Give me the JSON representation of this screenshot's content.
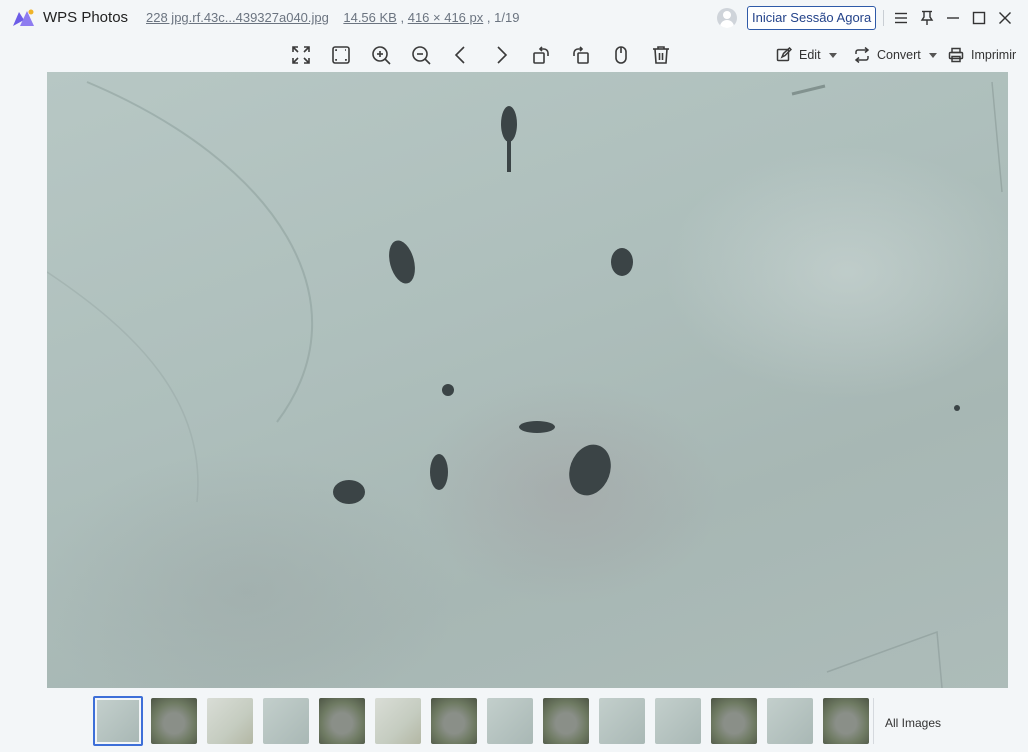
{
  "app": {
    "title": "WPS Photos",
    "file_name": "228 jpg.rf.43c...439327a040.jpg",
    "file_size": "14.56 KB",
    "dimensions": "416 × 416 px",
    "position": "1/19",
    "login_label": "Iniciar Sessão Agora"
  },
  "window_controls": [
    "menu-icon",
    "pin-icon",
    "minimize-icon",
    "maximize-icon",
    "close-icon"
  ],
  "toolbar": {
    "tools": [
      "fit-screen-icon",
      "actual-size-icon",
      "zoom-in-icon",
      "zoom-out-icon",
      "previous-icon",
      "next-icon",
      "rotate-left-icon",
      "rotate-right-icon",
      "mouse-icon",
      "delete-icon"
    ],
    "edit_label": "Edit",
    "convert_label": "Convert",
    "print_label": "Imprimir"
  },
  "thumbnails": {
    "count": 14,
    "selected_index": 0,
    "styles": [
      "t-light",
      "t-road",
      "t-grass",
      "t-light",
      "t-road",
      "t-grass",
      "t-road",
      "t-light",
      "t-road",
      "t-light",
      "t-light",
      "t-road",
      "t-light",
      "t-road"
    ],
    "all_images_label": "All Images"
  },
  "colors": {
    "accent": "#3d6fd8",
    "login_border": "#2f5aa8",
    "background": "#f3f6f8"
  }
}
